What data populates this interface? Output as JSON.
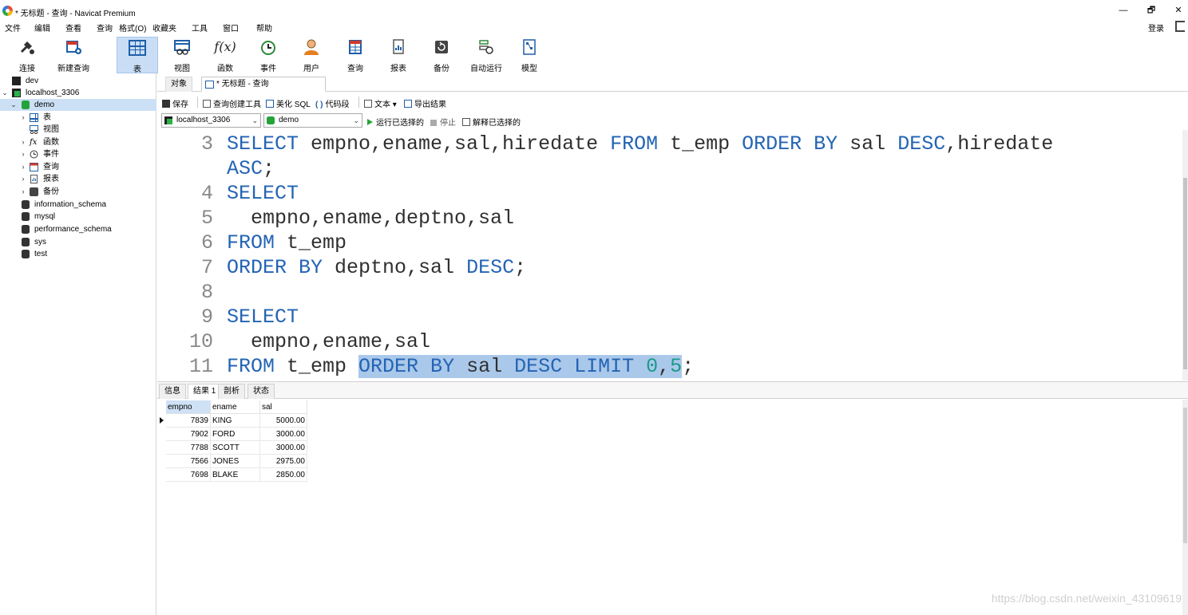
{
  "window": {
    "title": "* 无标题 - 查询 - Navicat Premium",
    "minimize": "—",
    "maximize": "🗗",
    "close": "✕"
  },
  "menu": {
    "items": [
      "文件",
      "编辑",
      "查看",
      "查询",
      "格式(O)",
      "收藏夹",
      "工具",
      "窗口",
      "帮助"
    ],
    "login": "登录"
  },
  "toolbar": {
    "items": [
      {
        "label": "连接",
        "icon": "plug-icon"
      },
      {
        "label": "新建查询",
        "icon": "new-query-icon"
      },
      {
        "label": "表",
        "icon": "table-icon",
        "active": true
      },
      {
        "label": "视图",
        "icon": "view-icon"
      },
      {
        "label": "函数",
        "icon": "function-icon",
        "glyph": "f(x)"
      },
      {
        "label": "事件",
        "icon": "clock-icon"
      },
      {
        "label": "用户",
        "icon": "user-icon"
      },
      {
        "label": "查询",
        "icon": "query-icon"
      },
      {
        "label": "报表",
        "icon": "report-icon"
      },
      {
        "label": "备份",
        "icon": "backup-icon"
      },
      {
        "label": "自动运行",
        "icon": "schedule-icon"
      },
      {
        "label": "模型",
        "icon": "model-icon"
      }
    ]
  },
  "sidebar": {
    "items": [
      {
        "label": "dev",
        "type": "connection",
        "level": 0
      },
      {
        "label": "localhost_3306",
        "type": "connection-open",
        "level": 0,
        "caret": "⌄"
      },
      {
        "label": "demo",
        "type": "database-open",
        "level": 1,
        "caret": "⌄",
        "selected": true
      },
      {
        "label": "表",
        "type": "tables",
        "level": 2,
        "caret": "›"
      },
      {
        "label": "视图",
        "type": "views",
        "level": 2
      },
      {
        "label": "函数",
        "type": "functions",
        "level": 2,
        "caret": "›"
      },
      {
        "label": "事件",
        "type": "events",
        "level": 2,
        "caret": "›"
      },
      {
        "label": "查询",
        "type": "queries",
        "level": 2,
        "caret": "›"
      },
      {
        "label": "报表",
        "type": "reports",
        "level": 2,
        "caret": "›"
      },
      {
        "label": "备份",
        "type": "backups",
        "level": 2,
        "caret": "›"
      },
      {
        "label": "information_schema",
        "type": "database",
        "level": 1
      },
      {
        "label": "mysql",
        "type": "database",
        "level": 1
      },
      {
        "label": "performance_schema",
        "type": "database",
        "level": 1
      },
      {
        "label": "sys",
        "type": "database",
        "level": 1
      },
      {
        "label": "test",
        "type": "database",
        "level": 1
      }
    ]
  },
  "tabs": {
    "objects": "对象",
    "query": "* 无标题 - 查询"
  },
  "query_toolbar": {
    "save": "保存",
    "builder": "查询创建工具",
    "beautify": "美化 SQL",
    "snippet": "代码段",
    "text": "文本",
    "text_caret": "▾",
    "export": "导出结果"
  },
  "selectors": {
    "connection": "localhost_3306",
    "database": "demo",
    "arrow": "⌄",
    "run_selected": "运行已选择的",
    "stop": "停止",
    "explain": "解释已选择的"
  },
  "editor": {
    "lines": [
      {
        "num": "3",
        "tokens": [
          [
            "kw",
            "SELECT"
          ],
          [
            "t",
            " empno,ename,sal,hiredate "
          ],
          [
            "kw",
            "FROM"
          ],
          [
            "t",
            " t_emp "
          ],
          [
            "kw",
            "ORDER BY"
          ],
          [
            "t",
            " sal "
          ],
          [
            "kw",
            "DESC"
          ],
          [
            "t",
            ",hiredate"
          ]
        ]
      },
      {
        "num": "",
        "tokens": [
          [
            "kw",
            "ASC"
          ],
          [
            "t",
            ";"
          ]
        ]
      },
      {
        "num": "4",
        "tokens": [
          [
            "kw",
            "SELECT"
          ]
        ]
      },
      {
        "num": "5",
        "tokens": [
          [
            "t",
            "  empno,ename,deptno,sal"
          ]
        ]
      },
      {
        "num": "6",
        "tokens": [
          [
            "kw",
            "FROM"
          ],
          [
            "t",
            " t_emp"
          ]
        ]
      },
      {
        "num": "7",
        "tokens": [
          [
            "kw",
            "ORDER BY"
          ],
          [
            "t",
            " deptno,sal "
          ],
          [
            "kw",
            "DESC"
          ],
          [
            "t",
            ";"
          ]
        ]
      },
      {
        "num": "8",
        "tokens": []
      },
      {
        "num": "9",
        "tokens": [
          [
            "kw",
            "SELECT"
          ]
        ]
      },
      {
        "num": "10",
        "tokens": [
          [
            "t",
            "  empno,ename,sal"
          ]
        ]
      },
      {
        "num": "11",
        "tokens": [
          [
            "kw",
            "FROM"
          ],
          [
            "t",
            " t_emp "
          ],
          [
            "selkw",
            "ORDER BY"
          ],
          [
            "sel",
            " sal "
          ],
          [
            "selkw",
            "DESC LIMIT"
          ],
          [
            "sel",
            " "
          ],
          [
            "selnum",
            "0"
          ],
          [
            "sel",
            ","
          ],
          [
            "selnum",
            "5"
          ],
          [
            "t",
            ";"
          ]
        ]
      }
    ]
  },
  "result_tabs": [
    "信息",
    "结果 1",
    "剖析",
    "状态"
  ],
  "result": {
    "columns": [
      "empno",
      "ename",
      "sal"
    ],
    "rows": [
      [
        "7839",
        "KING",
        "5000.00"
      ],
      [
        "7902",
        "FORD",
        "3000.00"
      ],
      [
        "7788",
        "SCOTT",
        "3000.00"
      ],
      [
        "7566",
        "JONES",
        "2975.00"
      ],
      [
        "7698",
        "BLAKE",
        "2850.00"
      ]
    ]
  },
  "watermark": "https://blog.csdn.net/weixin_43109619"
}
